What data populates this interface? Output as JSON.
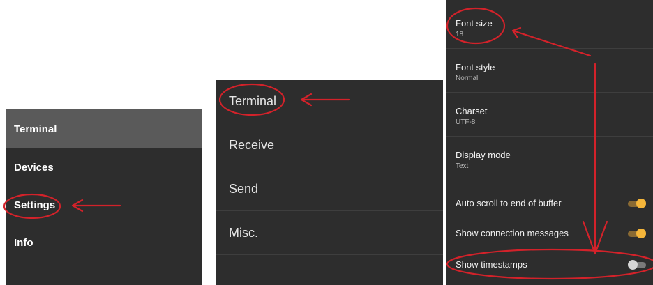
{
  "drawer": {
    "items": [
      {
        "label": "Terminal",
        "active": true
      },
      {
        "label": "Devices",
        "active": false
      },
      {
        "label": "Settings",
        "active": false
      },
      {
        "label": "Info",
        "active": false
      }
    ]
  },
  "settings_categories": {
    "items": [
      {
        "label": "Terminal"
      },
      {
        "label": "Receive"
      },
      {
        "label": "Send"
      },
      {
        "label": "Misc."
      }
    ]
  },
  "terminal_settings": {
    "font_size": {
      "title": "Font size",
      "value": "18"
    },
    "font_style": {
      "title": "Font style",
      "value": "Normal"
    },
    "charset": {
      "title": "Charset",
      "value": "UTF-8"
    },
    "display_mode": {
      "title": "Display mode",
      "value": "Text"
    },
    "auto_scroll": {
      "title": "Auto scroll to end of buffer",
      "enabled": true
    },
    "connection_messages": {
      "title": "Show connection messages",
      "enabled": true
    },
    "timestamps": {
      "title": "Show timestamps",
      "enabled": false
    }
  },
  "colors": {
    "panel_bg": "#2d2d2d",
    "active_bg": "#5a5a5a",
    "accent": "#f5b63a",
    "annotation": "#d3222a"
  }
}
